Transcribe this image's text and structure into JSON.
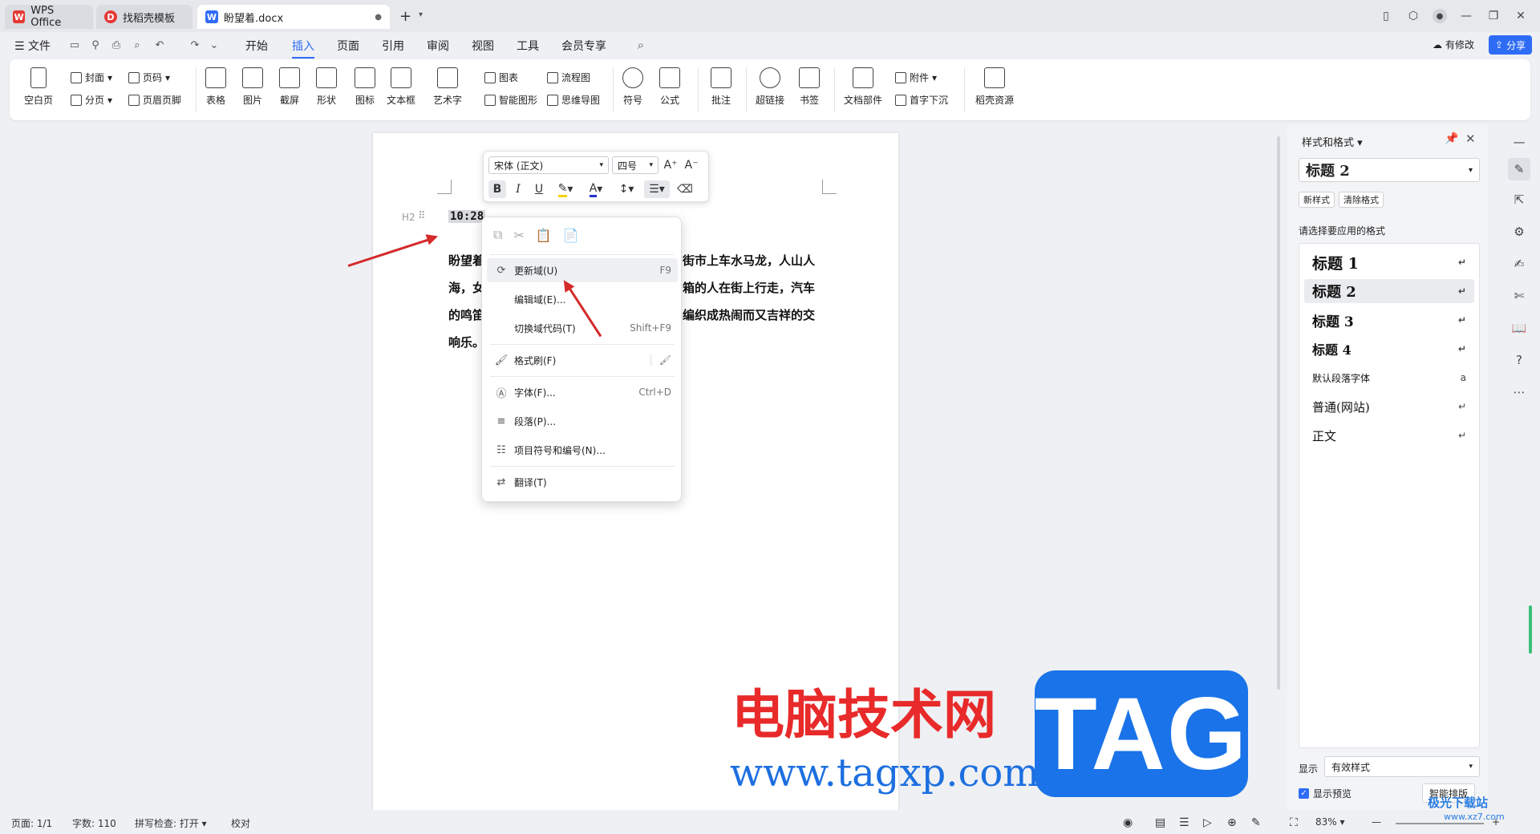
{
  "titlebar": {
    "tabs": [
      {
        "label": "WPS Office",
        "icon": "wps-logo-icon"
      },
      {
        "label": "找稻壳模板",
        "icon": "docer-logo-icon"
      },
      {
        "label": "盼望着.docx",
        "icon": "word-doc-icon"
      }
    ],
    "new_tab": "+"
  },
  "menu": {
    "file": "文件",
    "tabs": [
      "开始",
      "插入",
      "页面",
      "引用",
      "审阅",
      "视图",
      "工具",
      "会员专享"
    ],
    "active_tab": "插入",
    "modified": "有修改",
    "share": "分享"
  },
  "ribbon": {
    "blank_page": "空白页",
    "cover": "封面",
    "page_number": "页码",
    "page_break": "分页",
    "header_footer": "页眉页脚",
    "table": "表格",
    "picture": "图片",
    "screenshot": "截屏",
    "shape": "形状",
    "icon": "图标",
    "textbox": "文本框",
    "wordart": "艺术字",
    "chart": "图表",
    "smart_art": "智能图形",
    "flowchart": "流程图",
    "mindmap": "思维导图",
    "symbol": "符号",
    "formula": "公式",
    "comment": "批注",
    "hyperlink": "超链接",
    "bookmark": "书签",
    "doc_parts": "文档部件",
    "attachment": "附件",
    "drop_cap": "首字下沉",
    "docer_resources": "稻壳资源"
  },
  "float_toolbar": {
    "font": "宋体 (正文)",
    "size": "四号"
  },
  "document": {
    "heading_marker": "H2",
    "field_time": "10:28",
    "lines": [
      {
        "left": "盼望着",
        "right": "街市上车水马龙，人山人"
      },
      {
        "left": "海，女",
        "right": "箱的人在街上行走，汽车"
      },
      {
        "left": "的鸣笛",
        "right": "编织成热闹而又吉祥的交"
      },
      {
        "left": "响乐。",
        "right": ""
      }
    ]
  },
  "context_menu": {
    "items": [
      {
        "label": "更新域(U)",
        "shortcut": "F9",
        "icon": "refresh-field-icon"
      },
      {
        "label": "编辑域(E)...",
        "shortcut": "",
        "icon": ""
      },
      {
        "label": "切换域代码(T)",
        "shortcut": "Shift+F9",
        "icon": ""
      },
      {
        "label": "格式刷(F)",
        "shortcut": "",
        "icon": "format-painter-icon"
      },
      {
        "label": "字体(F)...",
        "shortcut": "Ctrl+D",
        "icon": "font-icon"
      },
      {
        "label": "段落(P)...",
        "shortcut": "",
        "icon": "paragraph-icon"
      },
      {
        "label": "项目符号和编号(N)...",
        "shortcut": "",
        "icon": "list-icon"
      },
      {
        "label": "翻译(T)",
        "shortcut": "",
        "icon": "translate-icon"
      }
    ]
  },
  "styles_panel": {
    "title": "样式和格式",
    "current": "标题 2",
    "new_style": "新样式",
    "clear_format": "清除格式",
    "prompt": "请选择要应用的格式",
    "styles": [
      "标题 1",
      "标题 2",
      "标题 3",
      "标题 4",
      "默认段落字体",
      "普通(网站)",
      "正文"
    ],
    "show_label": "显示",
    "show_value": "有效样式",
    "preview_label": "显示预览",
    "smart_layout": "智能排版"
  },
  "status": {
    "page": "页面: 1/1",
    "words": "字数: 110",
    "spell": "拼写检查: 打开",
    "proof": "校对",
    "zoom": "83%"
  },
  "watermark": {
    "cn": "电脑技术网",
    "url": "www.tagxp.com",
    "tag": "TAG",
    "site2": "极光下载站",
    "site2_url": "www.xz7.com"
  },
  "colors": {
    "accent": "#2f6cf6",
    "wps_red": "#e53935",
    "arrow": "#d42a2a"
  }
}
